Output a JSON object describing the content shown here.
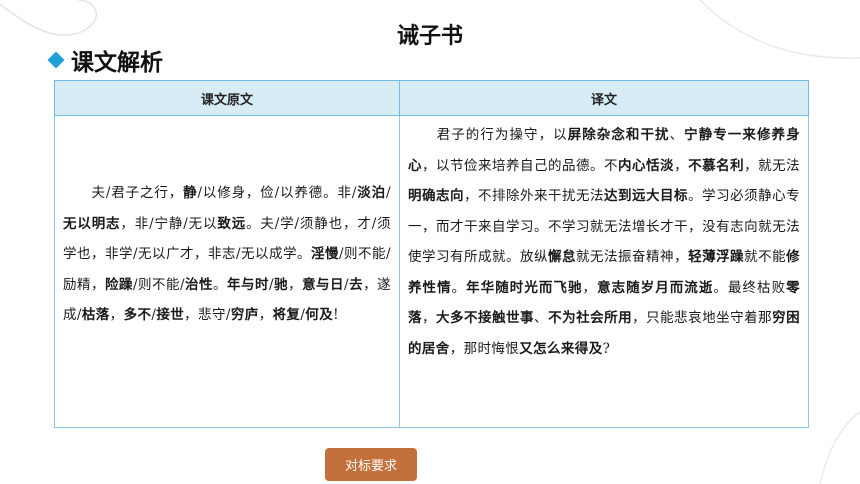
{
  "slide": {
    "title": "诫子书"
  },
  "section": {
    "heading": "课文解析",
    "icon": "diamond-icon",
    "accent_color": "#1fa0d8"
  },
  "table": {
    "headers": [
      "课文原文",
      "译文"
    ],
    "header_bg": "#d8ecf6",
    "original_segments": [
      {
        "t": "夫/君子之行，",
        "b": false
      },
      {
        "t": "静",
        "b": true
      },
      {
        "t": "/以修身，俭/以养德。非/",
        "b": false
      },
      {
        "t": "淡泊",
        "b": true
      },
      {
        "t": "/",
        "b": false
      },
      {
        "t": "无以明志",
        "b": true
      },
      {
        "t": "，非/宁静/无以",
        "b": false
      },
      {
        "t": "致远",
        "b": true
      },
      {
        "t": "。夫/学/须静也，才/须学也，非学/无以广才，非志/无以成学。",
        "b": false
      },
      {
        "t": "淫慢",
        "b": true
      },
      {
        "t": "/则不能/励精，",
        "b": false
      },
      {
        "t": "险躁",
        "b": true
      },
      {
        "t": "/则不能/",
        "b": false
      },
      {
        "t": "治性",
        "b": true
      },
      {
        "t": "。",
        "b": false
      },
      {
        "t": "年与时",
        "b": true
      },
      {
        "t": "/",
        "b": false
      },
      {
        "t": "驰",
        "b": true
      },
      {
        "t": "，",
        "b": false
      },
      {
        "t": "意与日",
        "b": true
      },
      {
        "t": "/",
        "b": false
      },
      {
        "t": "去",
        "b": true
      },
      {
        "t": "，遂成/",
        "b": false
      },
      {
        "t": "枯落",
        "b": true
      },
      {
        "t": "，",
        "b": false
      },
      {
        "t": "多不",
        "b": true
      },
      {
        "t": "/",
        "b": false
      },
      {
        "t": "接世",
        "b": true
      },
      {
        "t": "，悲守/",
        "b": false
      },
      {
        "t": "穷庐",
        "b": true
      },
      {
        "t": "，",
        "b": false
      },
      {
        "t": "将复",
        "b": true
      },
      {
        "t": "/",
        "b": false
      },
      {
        "t": "何及",
        "b": true
      },
      {
        "t": "!",
        "b": false
      }
    ],
    "translation_segments": [
      {
        "t": "君子的行为操守，以",
        "b": false
      },
      {
        "t": "屏除杂念和干扰",
        "b": true
      },
      {
        "t": "、",
        "b": false
      },
      {
        "t": "宁静专一来修养身心",
        "b": true
      },
      {
        "t": "，以节俭来培养自己的品德。不",
        "b": false
      },
      {
        "t": "内心恬淡",
        "b": true
      },
      {
        "t": "，",
        "b": false
      },
      {
        "t": "不慕名利",
        "b": true
      },
      {
        "t": "，就无法",
        "b": false
      },
      {
        "t": "明确志向",
        "b": true
      },
      {
        "t": "，不排除外来干扰无法",
        "b": false
      },
      {
        "t": "达到远大目标",
        "b": true
      },
      {
        "t": "。学习必须静心专一，而才干来自学习。不学习就无法增长才干，没有志向就无法使学习有所成就。放纵",
        "b": false
      },
      {
        "t": "懈怠",
        "b": true
      },
      {
        "t": "就无法振奋精神，",
        "b": false
      },
      {
        "t": "轻薄浮躁",
        "b": true
      },
      {
        "t": "就不能",
        "b": false
      },
      {
        "t": "修养性情",
        "b": true
      },
      {
        "t": "。",
        "b": false
      },
      {
        "t": "年华随时光而飞驰",
        "b": true
      },
      {
        "t": "，",
        "b": false
      },
      {
        "t": "意志随岁月而流逝",
        "b": true
      },
      {
        "t": "。最终枯败",
        "b": false
      },
      {
        "t": "零落",
        "b": true
      },
      {
        "t": "，",
        "b": false
      },
      {
        "t": "大多不接触世事",
        "b": true
      },
      {
        "t": "、",
        "b": false
      },
      {
        "t": "不为社会所用",
        "b": true
      },
      {
        "t": "，只能悲哀地坐守着那",
        "b": false
      },
      {
        "t": "穷困的居舍",
        "b": true
      },
      {
        "t": "，那时悔恨",
        "b": false
      },
      {
        "t": "又怎么来得及",
        "b": true
      },
      {
        "t": "?",
        "b": false
      }
    ]
  },
  "footer": {
    "button_label": "对标要求",
    "button_color": "#c4703c"
  }
}
